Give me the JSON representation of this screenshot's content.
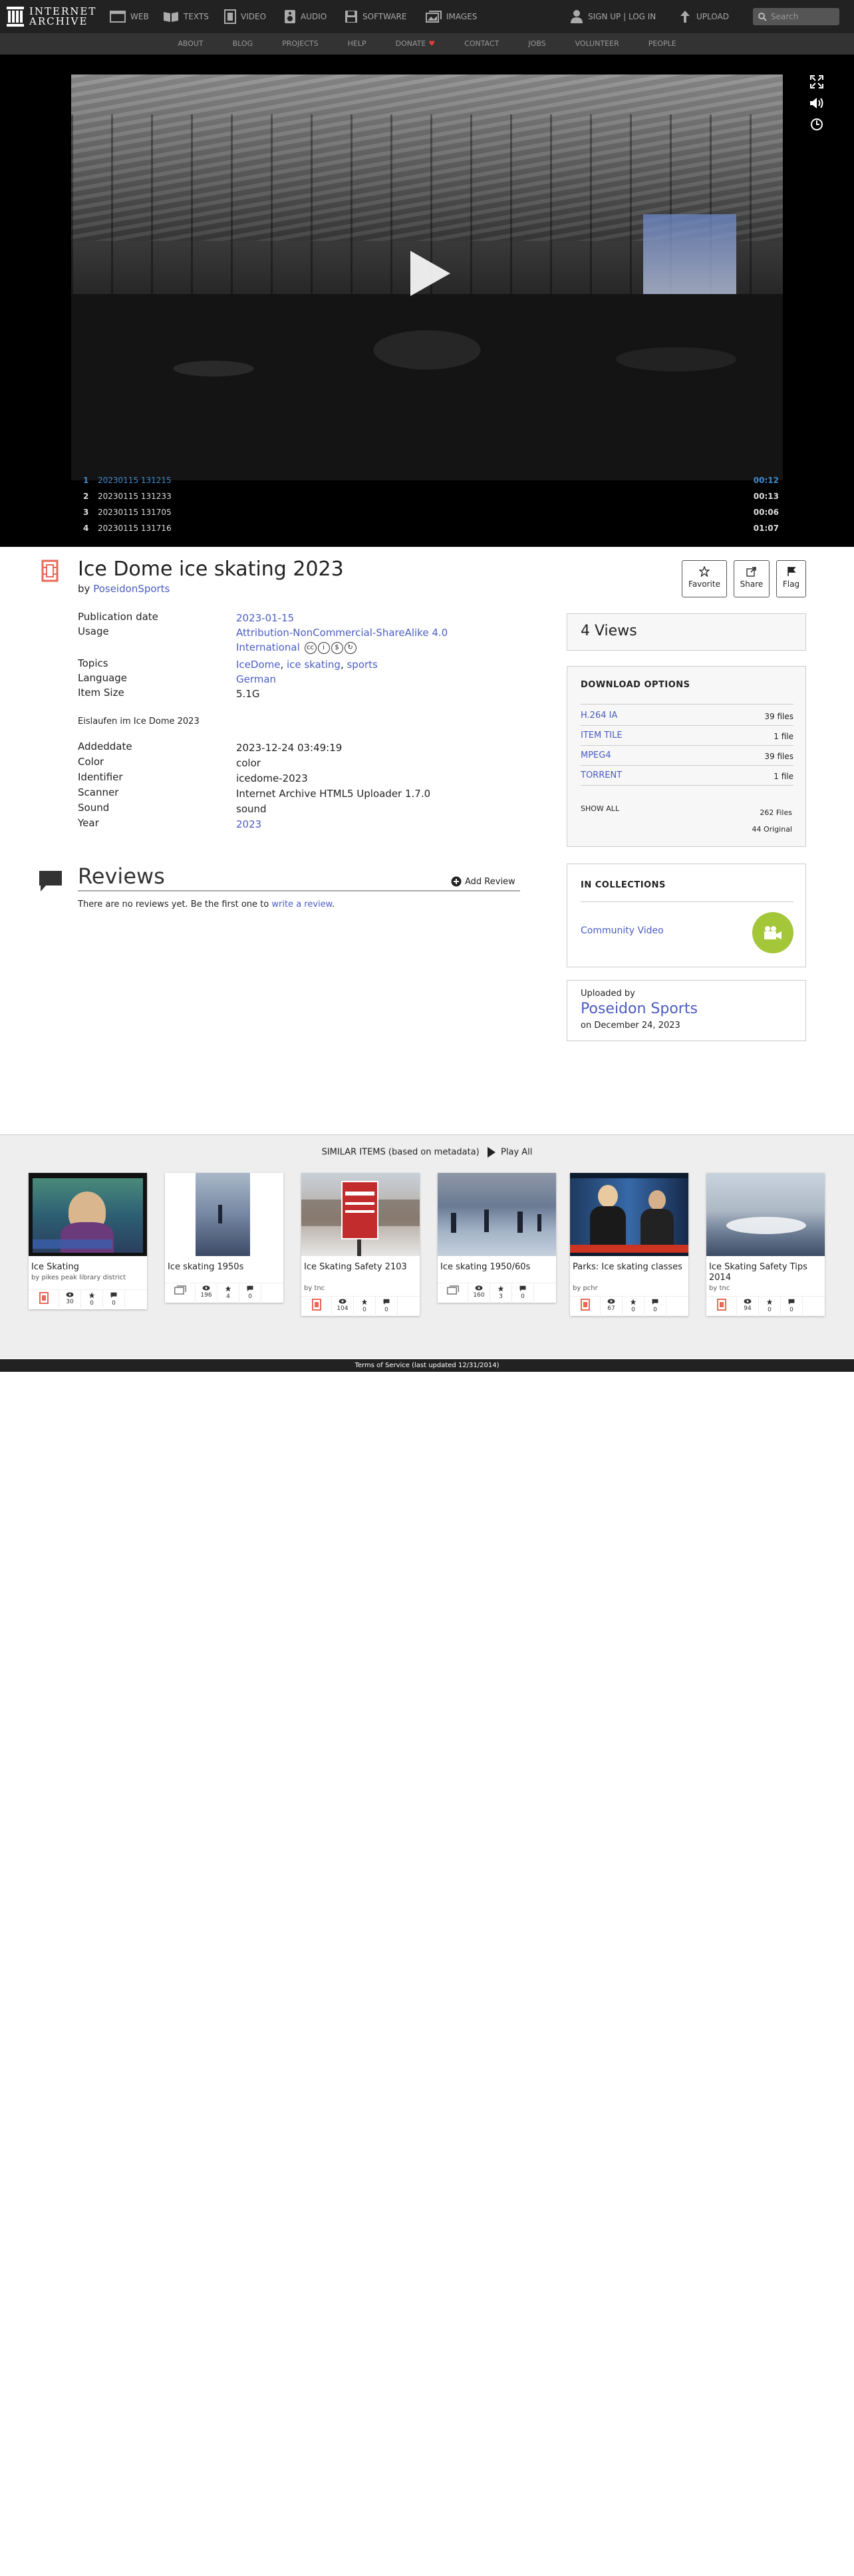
{
  "nav": {
    "logo_line1": "INTERNET",
    "logo_line2": "ARCHIVE",
    "items": [
      {
        "label": "WEB"
      },
      {
        "label": "TEXTS"
      },
      {
        "label": "VIDEO"
      },
      {
        "label": "AUDIO"
      },
      {
        "label": "SOFTWARE"
      },
      {
        "label": "IMAGES"
      }
    ],
    "signup": "SIGN UP | LOG IN",
    "upload": "UPLOAD",
    "search_placeholder": "Search"
  },
  "subnav": [
    "ABOUT",
    "BLOG",
    "PROJECTS",
    "HELP",
    "DONATE",
    "CONTACT",
    "JOBS",
    "VOLUNTEER",
    "PEOPLE"
  ],
  "playlist": [
    {
      "n": "1",
      "title": "20230115 131215",
      "dur": "00:12"
    },
    {
      "n": "2",
      "title": "20230115 131233",
      "dur": "00:13"
    },
    {
      "n": "3",
      "title": "20230115 131705",
      "dur": "00:06"
    },
    {
      "n": "4",
      "title": "20230115 131716",
      "dur": "01:07"
    }
  ],
  "item": {
    "title": "Ice Dome ice skating 2023",
    "by_prefix": "by",
    "creator": "PoseidonSports",
    "actions": {
      "favorite": "Favorite",
      "share": "Share",
      "flag": "Flag"
    }
  },
  "metadata": {
    "publication_date_label": "Publication date",
    "publication_date": "2023-01-15",
    "usage_label": "Usage",
    "usage_line1": "Attribution-NonCommercial-ShareAlike 4.0",
    "usage_line2": "International",
    "topics_label": "Topics",
    "topics": [
      "IceDome",
      "ice skating",
      "sports"
    ],
    "language_label": "Language",
    "language": "German",
    "item_size_label": "Item Size",
    "item_size": "5.1G",
    "description": "Eislaufen im Ice Dome 2023",
    "addeddate_label": "Addeddate",
    "addeddate": "2023-12-24 03:49:19",
    "color_label": "Color",
    "color": "color",
    "identifier_label": "Identifier",
    "identifier": "icedome-2023",
    "scanner_label": "Scanner",
    "scanner": "Internet Archive HTML5 Uploader 1.7.0",
    "sound_label": "Sound",
    "sound": "sound",
    "year_label": "Year",
    "year": "2023"
  },
  "reviews": {
    "heading": "Reviews",
    "add_review": "Add Review",
    "empty_text": "There are no reviews yet. Be the first one to",
    "write_link": "write a review",
    "period": "."
  },
  "sidebar": {
    "views": "4 Views",
    "download_heading": "DOWNLOAD OPTIONS",
    "downloads": [
      {
        "format": "H.264 IA",
        "count": "39 files"
      },
      {
        "format": "ITEM TILE",
        "count": "1 file"
      },
      {
        "format": "MPEG4",
        "count": "39 files"
      },
      {
        "format": "TORRENT",
        "count": "1 file"
      }
    ],
    "show_all": "SHOW ALL",
    "total_files": "262 Files",
    "total_original": "44 Original",
    "collections_heading": "IN COLLECTIONS",
    "collection": "Community Video",
    "uploaded_by_label": "Uploaded by",
    "uploader": "Poseidon Sports",
    "uploaded_on": "on December 24, 2023"
  },
  "similar": {
    "heading": "SIMILAR ITEMS (based on metadata)",
    "play_all": "Play All",
    "cards": [
      {
        "title": "Ice Skating",
        "by": "by pikes peak library district",
        "views": "30",
        "favs": "0",
        "reviews": "0"
      },
      {
        "title": "Ice skating 1950s",
        "by": "",
        "views": "196",
        "favs": "4",
        "reviews": "0"
      },
      {
        "title": "Ice Skating Safety 2103",
        "by": "by tnc",
        "views": "104",
        "favs": "0",
        "reviews": "0"
      },
      {
        "title": "Ice skating 1950/60s",
        "by": "",
        "views": "160",
        "favs": "3",
        "reviews": "0"
      },
      {
        "title": "Parks: Ice skating classes",
        "by": "by pchr",
        "views": "67",
        "favs": "0",
        "reviews": "0"
      },
      {
        "title": "Ice Skating Safety Tips 2014",
        "by": "by tnc",
        "views": "94",
        "favs": "0",
        "reviews": "0"
      }
    ]
  },
  "footer": "Terms of Service (last updated 12/31/2014)"
}
